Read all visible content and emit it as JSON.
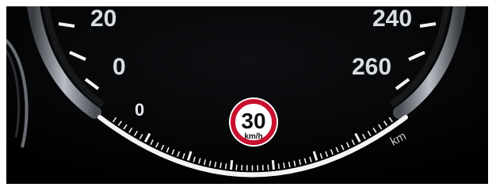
{
  "speedometer": {
    "labels": {
      "speed_20": "20",
      "speed_0": "0",
      "speed_240": "240",
      "speed_260": "260"
    },
    "unit": "km"
  },
  "gauge": {
    "zero_label": "0",
    "level": 0
  },
  "speed_limit_sign": {
    "value": "30",
    "unit": "km/h"
  },
  "colors": {
    "background": "#020203",
    "numerals": "#d9dde3",
    "tick": "#f4f4f4",
    "sign_ring": "#c8102e",
    "sign_fill": "#ffffff",
    "sign_text": "#111111",
    "bezel": "#8a8f96"
  }
}
